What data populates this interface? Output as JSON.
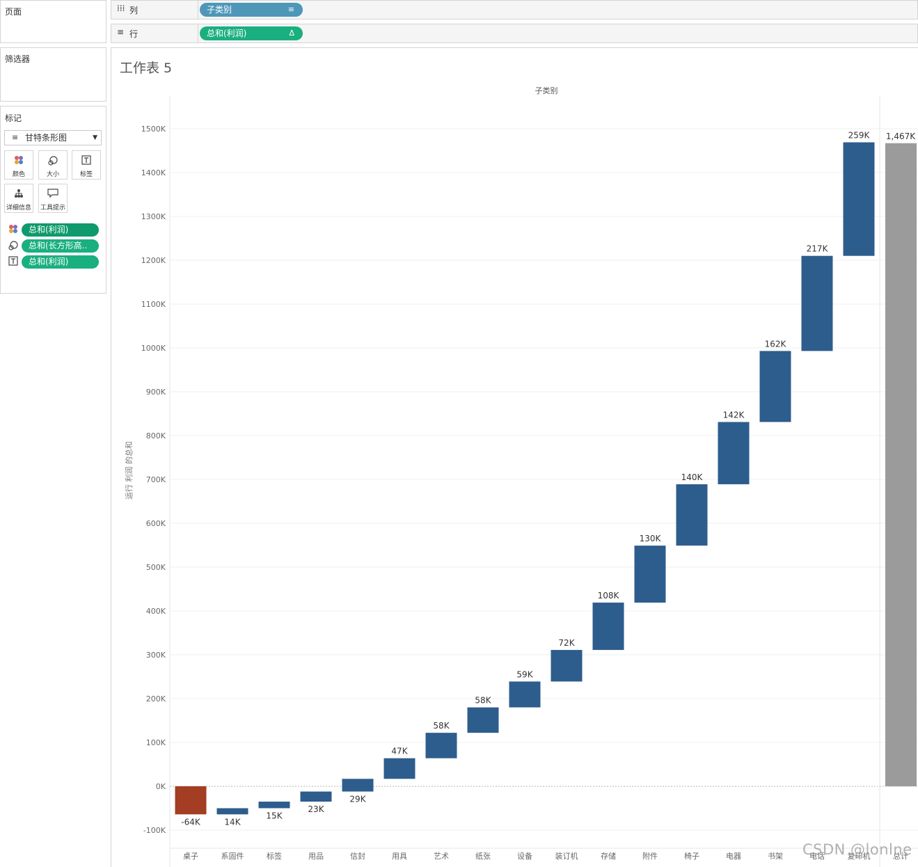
{
  "left_panel": {
    "pages_title": "页面",
    "filters_title": "筛选器",
    "marks_title": "标记",
    "mark_type": "甘特条形图",
    "mark_buttons": [
      {
        "label": "颜色",
        "icon": "color-icon"
      },
      {
        "label": "大小",
        "icon": "size-icon"
      },
      {
        "label": "标签",
        "icon": "label-icon"
      },
      {
        "label": "详细信息",
        "icon": "detail-icon"
      },
      {
        "label": "工具提示",
        "icon": "tooltip-icon"
      }
    ],
    "mark_pills": [
      {
        "icon": "color-icon",
        "label": "总和(利润)"
      },
      {
        "icon": "size-icon",
        "label": "总和(长方形高.."
      },
      {
        "icon": "label-icon",
        "label": "总和(利润)"
      }
    ]
  },
  "shelves": {
    "columns_label": "列",
    "columns_pill": "子类别",
    "rows_label": "行",
    "rows_pill": "总和(利润)",
    "rows_pill_icon": "Δ"
  },
  "sheet": {
    "title": "工作表 5",
    "header": "子类别",
    "y_axis_label": "运行 利润 的总和"
  },
  "watermark": "CSDN @lonlne",
  "chart_data": {
    "type": "bar",
    "subtype": "waterfall",
    "title": "工作表 5",
    "xlabel": "子类别",
    "ylabel": "运行 利润 的总和",
    "ylim": [
      -100000,
      1500000
    ],
    "yticks": [
      "-100K",
      "0K",
      "100K",
      "200K",
      "300K",
      "400K",
      "500K",
      "600K",
      "700K",
      "800K",
      "900K",
      "1000K",
      "1100K",
      "1200K",
      "1300K",
      "1400K",
      "1500K"
    ],
    "categories": [
      "桌子",
      "系固件",
      "标签",
      "用品",
      "信封",
      "用具",
      "艺术",
      "纸张",
      "设备",
      "装订机",
      "存储",
      "附件",
      "椅子",
      "电器",
      "书架",
      "电话",
      "复印机"
    ],
    "values": [
      -64000,
      14000,
      15000,
      23000,
      29000,
      47000,
      58000,
      58000,
      59000,
      72000,
      108000,
      130000,
      140000,
      142000,
      162000,
      217000,
      259000
    ],
    "labels": [
      "-64K",
      "14K",
      "15K",
      "23K",
      "29K",
      "47K",
      "58K",
      "58K",
      "59K",
      "72K",
      "108K",
      "130K",
      "140K",
      "142K",
      "162K",
      "217K",
      "259K"
    ],
    "total": {
      "label": "总计",
      "value": 1467000,
      "text": "1,467K"
    },
    "colors": {
      "positive": "#2d5d8d",
      "negative": "#a33d23",
      "total": "#9b9b9b"
    },
    "grid": true
  }
}
